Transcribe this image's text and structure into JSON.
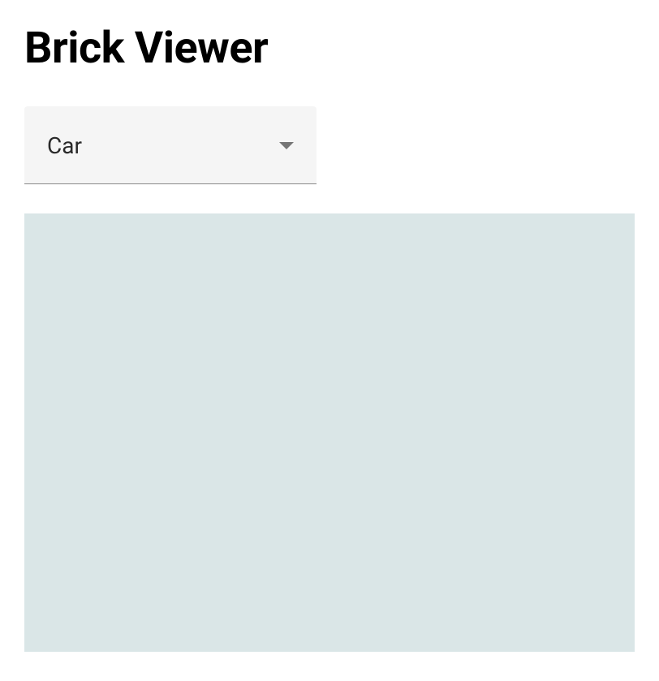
{
  "header": {
    "title": "Brick Viewer"
  },
  "select": {
    "value": "Car"
  }
}
